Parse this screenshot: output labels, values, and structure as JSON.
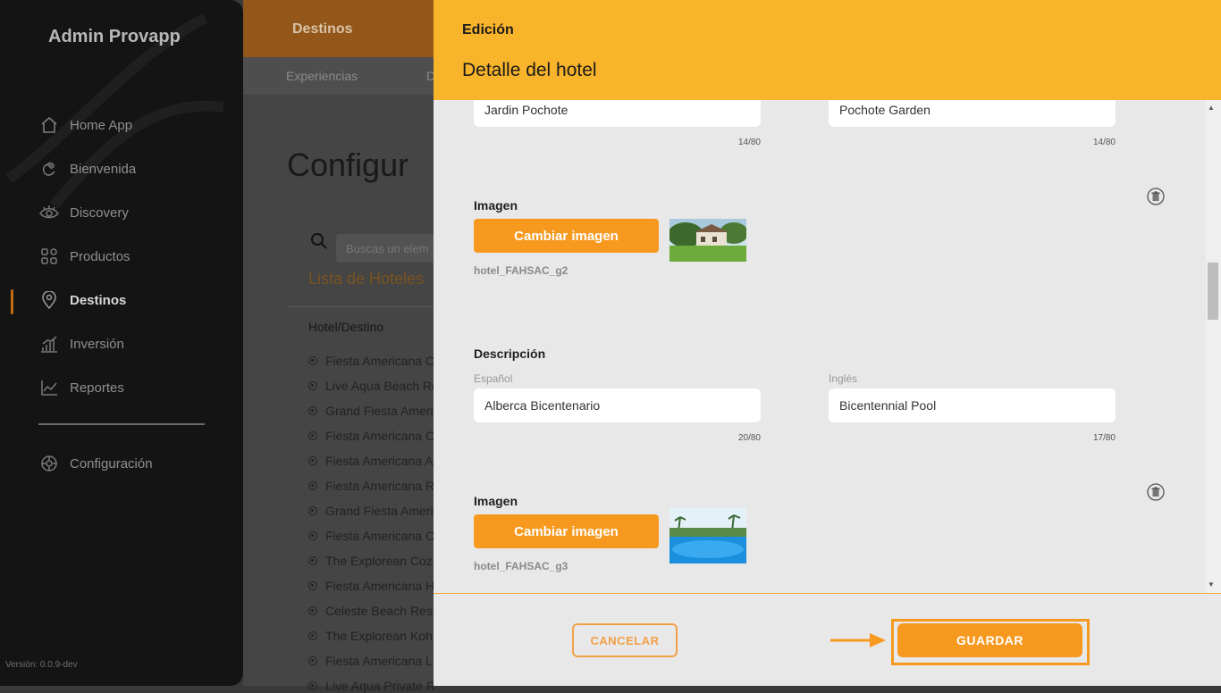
{
  "sidebar": {
    "brand": "Admin Provapp",
    "items": [
      {
        "label": "Home App",
        "icon": "home-icon"
      },
      {
        "label": "Bienvenida",
        "icon": "wave-hand-icon"
      },
      {
        "label": "Discovery",
        "icon": "eye-icon"
      },
      {
        "label": "Productos",
        "icon": "grid-icon"
      },
      {
        "label": "Destinos",
        "icon": "location-pin-icon",
        "active": true
      },
      {
        "label": "Inversión",
        "icon": "bar-chart-icon"
      },
      {
        "label": "Reportes",
        "icon": "line-chart-icon"
      }
    ],
    "settings_label": "Configuración",
    "version": "Versión: 0.0.9-dev"
  },
  "topnav": {
    "tab": "Destinos",
    "subtabs": [
      "Experiencias",
      "D"
    ]
  },
  "main": {
    "title": "Configur",
    "search_placeholder": "Buscas un elem",
    "list_title": "Lista de Hoteles",
    "column_header": "Hotel/Destino",
    "hotels": [
      "Fiesta Americana C",
      "Live Aqua Beach Re",
      "Grand Fiesta Ameri",
      "Fiesta Americana C",
      "Fiesta Americana A",
      "Fiesta Americana R",
      "Grand Fiesta Ameri",
      "Fiesta Americana C",
      "The Explorean Cozu",
      "Fiesta Americana H",
      "Celeste Beach Resi",
      "The Explorean Koh",
      "Fiesta Americana L",
      "Live Aqua Private R"
    ]
  },
  "panel": {
    "header_small": "Edición",
    "header_title": "Detalle del hotel",
    "top_fields": {
      "es_value": "Jardin Pochote",
      "es_counter": "14/80",
      "en_value": "Pochote Garden",
      "en_counter": "14/80"
    },
    "image1": {
      "label": "Imagen",
      "button": "Cambiar imagen",
      "filename": "hotel_FAHSAC_g2"
    },
    "description": {
      "label": "Descripción",
      "es_label": "Español",
      "en_label": "Inglés",
      "es_value": "Alberca Bicentenario",
      "es_counter": "20/80",
      "en_value": "Bicentennial Pool",
      "en_counter": "17/80"
    },
    "image2": {
      "label": "Imagen",
      "button": "Cambiar imagen",
      "filename": "hotel_FAHSAC_g3"
    },
    "footer": {
      "cancel": "CANCELAR",
      "save": "GUARDAR"
    }
  },
  "colors": {
    "accent": "#f7991f",
    "header": "#f8b42a",
    "sidebar": "#141414"
  }
}
